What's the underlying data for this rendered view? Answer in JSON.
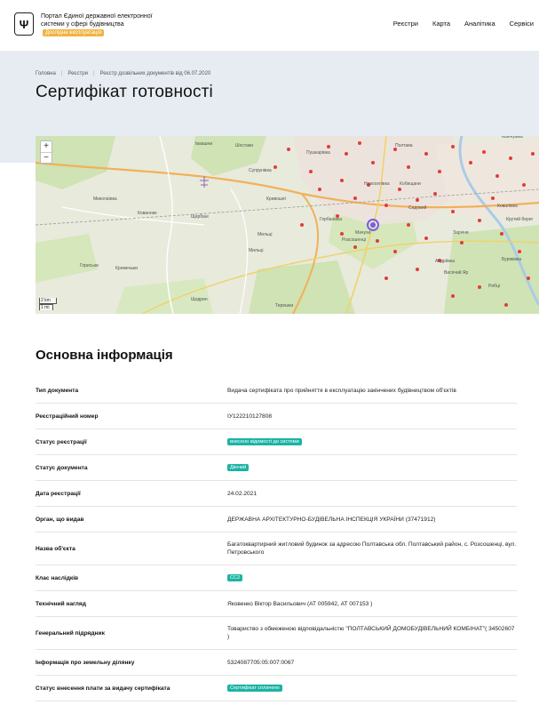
{
  "header": {
    "portal_name": "Портал Єдиної державної електронної системи у сфері будівництва",
    "beta_label": "Дослідна експлуатація",
    "logo_glyph": "Ψ",
    "nav": [
      "Реєстри",
      "Карта",
      "Аналітика",
      "Сервіси"
    ]
  },
  "breadcrumb": [
    "Головна",
    "Реєстри",
    "Реєстр дозвільних документів від 06.07.2020"
  ],
  "page_title": "Сертифікат готовності",
  "map": {
    "zoom_in": "+",
    "zoom_out": "−",
    "scale_km": "2 km",
    "scale_mi": "1 mi",
    "labels": [
      "Шостаки",
      "Іваашни",
      "Пушкарівка",
      "Полтава",
      "Манчуівка",
      "Супрунівка",
      "Горбанівка",
      "Розсошенці",
      "Кобищани",
      "Новоселівка",
      "Миколаївка",
      "Кованник",
      "Щербані",
      "Кривошеї",
      "Мильці",
      "Мильці",
      "Мачухи",
      "Садовий",
      "Андріївка",
      "Заріччя",
      "Ковалівка",
      "Буряківка",
      "Рибці",
      "Крутий берег",
      "Терешки",
      "Гориськи",
      "Кременьки",
      "Щедрин",
      "Висячий Яр"
    ]
  },
  "section_title": "Основна інформація",
  "rows": [
    {
      "label": "Тип документа",
      "value": "Видача сертифіката про прийняття в експлуатацію закінчених будівництвом об'єктів"
    },
    {
      "label": "Реєстраційний номер",
      "value": "ІУ122210127808"
    },
    {
      "label": "Статус реєстрації",
      "value": "внесено відомості до системи",
      "badge": true
    },
    {
      "label": "Статус документа",
      "value": "Діючий",
      "badge": true
    },
    {
      "label": "Дата реєстрації",
      "value": "24.02.2021"
    },
    {
      "label": "Орган, що видав",
      "value": "ДЕРЖАВНА АРХІТЕКТУРНО-БУДІВЕЛЬНА ІНСПЕКЦІЯ УКРАЇНИ (37471912)"
    },
    {
      "label": "Назва об'єкта",
      "value": "Багатоквартирний житловий будинок за адресою Полтавська обл. Полтавський район, с. Розсошенці, вул. Петровського"
    },
    {
      "label": "Клас наслідків",
      "value": "СС2",
      "badge": true
    },
    {
      "label": "Технічний нагляд",
      "value": "Яковенко Віктор Васильович (АТ 005942, АТ 007153 )"
    },
    {
      "label": "Генеральний підрядник",
      "value": "Товариство з обмеженою відповідальністю \"ПОЛТАВСЬКИЙ ДОМОБУДІВЕЛЬНИЙ КОМБІНАТ\"( 34502607 )"
    },
    {
      "label": "Інформація про земельну ділянку",
      "value": "5324087705:05:007:0067"
    },
    {
      "label": "Статус внесення плати за видачу сертифіката",
      "value": "Сертифікат сплачено",
      "badge": true
    }
  ]
}
